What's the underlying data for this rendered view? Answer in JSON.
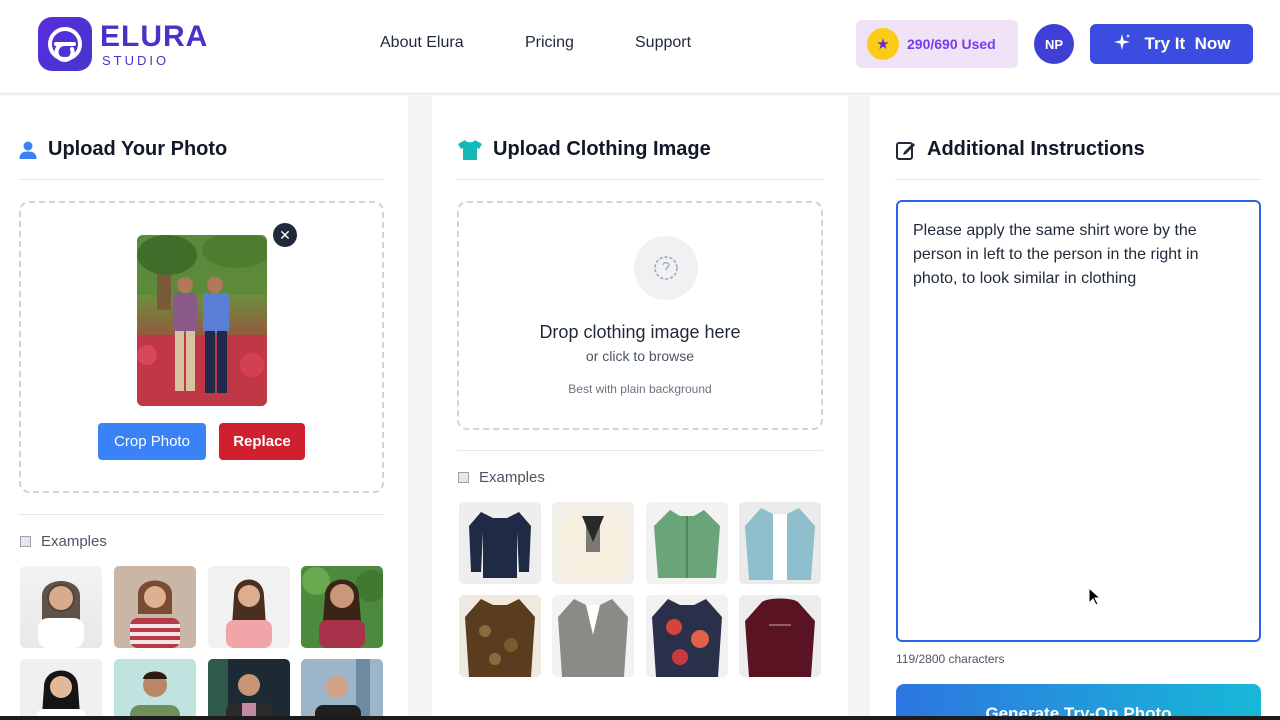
{
  "brand": {
    "name": "ELURA",
    "sub": "STUDIO",
    "accent": "#4c31c9"
  },
  "nav": {
    "about": "About Elura",
    "pricing": "Pricing",
    "support": "Support"
  },
  "credits": {
    "text": "290/690 Used",
    "icon": "star-icon"
  },
  "user": {
    "initials": "NP"
  },
  "cta": {
    "label": "Try It  Now",
    "icon": "sparkle-icon"
  },
  "upload_photo": {
    "title": "Upload Your Photo",
    "icon": "user-icon",
    "crop_label": "Crop Photo",
    "replace_label": "Replace",
    "examples_label": "Examples"
  },
  "upload_clothing": {
    "title": "Upload Clothing Image",
    "icon": "shirt-icon",
    "drop_title": "Drop clothing image here",
    "drop_sub": "or click to browse",
    "drop_hint": "Best with plain background",
    "examples_label": "Examples"
  },
  "instructions": {
    "title": "Additional Instructions",
    "icon": "edit-icon",
    "text": "Please apply the same shirt wore by the person in left to the person in the right in photo, to look similar in clothing",
    "char_count": "119/2800 characters",
    "generate_label": "Generate Try-On Photo"
  }
}
